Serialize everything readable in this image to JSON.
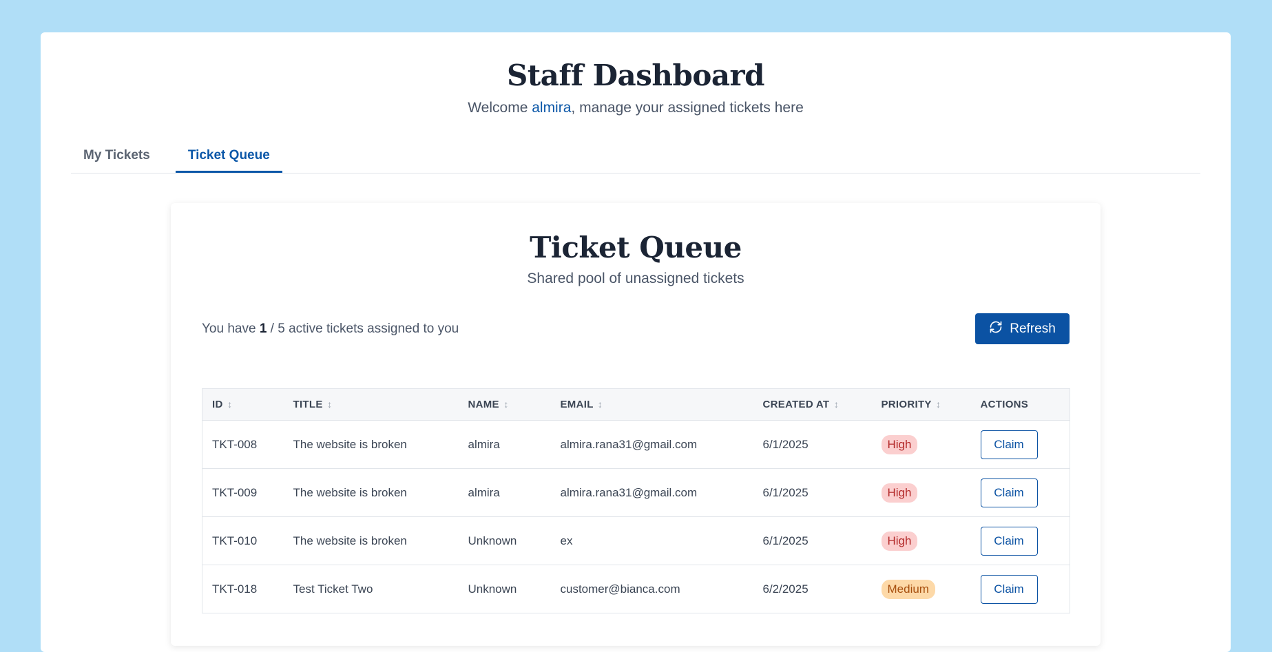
{
  "header": {
    "title": "Staff Dashboard",
    "welcome_prefix": "Welcome ",
    "username": "almira",
    "welcome_suffix": ", manage your assigned tickets here"
  },
  "tabs": [
    {
      "label": "My Tickets",
      "active": false
    },
    {
      "label": "Ticket Queue",
      "active": true
    }
  ],
  "queue": {
    "title": "Ticket Queue",
    "subtitle": "Shared pool of unassigned tickets",
    "status_prefix": "You have ",
    "active_count": "1",
    "status_suffix": " / 5 active tickets assigned to you",
    "refresh_label": "Refresh",
    "columns": [
      "ID",
      "TITLE",
      "NAME",
      "EMAIL",
      "CREATED AT",
      "PRIORITY",
      "ACTIONS"
    ],
    "rows": [
      {
        "id": "TKT-008",
        "title": "The website is broken",
        "name": "almira",
        "email": "almira.rana31@gmail.com",
        "created": "6/1/2025",
        "priority": "High",
        "action": "Claim"
      },
      {
        "id": "TKT-009",
        "title": "The website is broken",
        "name": "almira",
        "email": "almira.rana31@gmail.com",
        "created": "6/1/2025",
        "priority": "High",
        "action": "Claim"
      },
      {
        "id": "TKT-010",
        "title": "The website is broken",
        "name": "Unknown",
        "email": "ex",
        "created": "6/1/2025",
        "priority": "High",
        "action": "Claim"
      },
      {
        "id": "TKT-018",
        "title": "Test Ticket Two",
        "name": "Unknown",
        "email": "customer@bianca.com",
        "created": "6/2/2025",
        "priority": "Medium",
        "action": "Claim"
      }
    ]
  },
  "colors": {
    "background": "#b0def7",
    "accent": "#0b52a3",
    "high_badge": "#fbcfcf",
    "medium_badge": "#fdd9a8"
  },
  "icons": {
    "refresh": "refresh-icon",
    "sort": "sort-arrows-icon"
  }
}
